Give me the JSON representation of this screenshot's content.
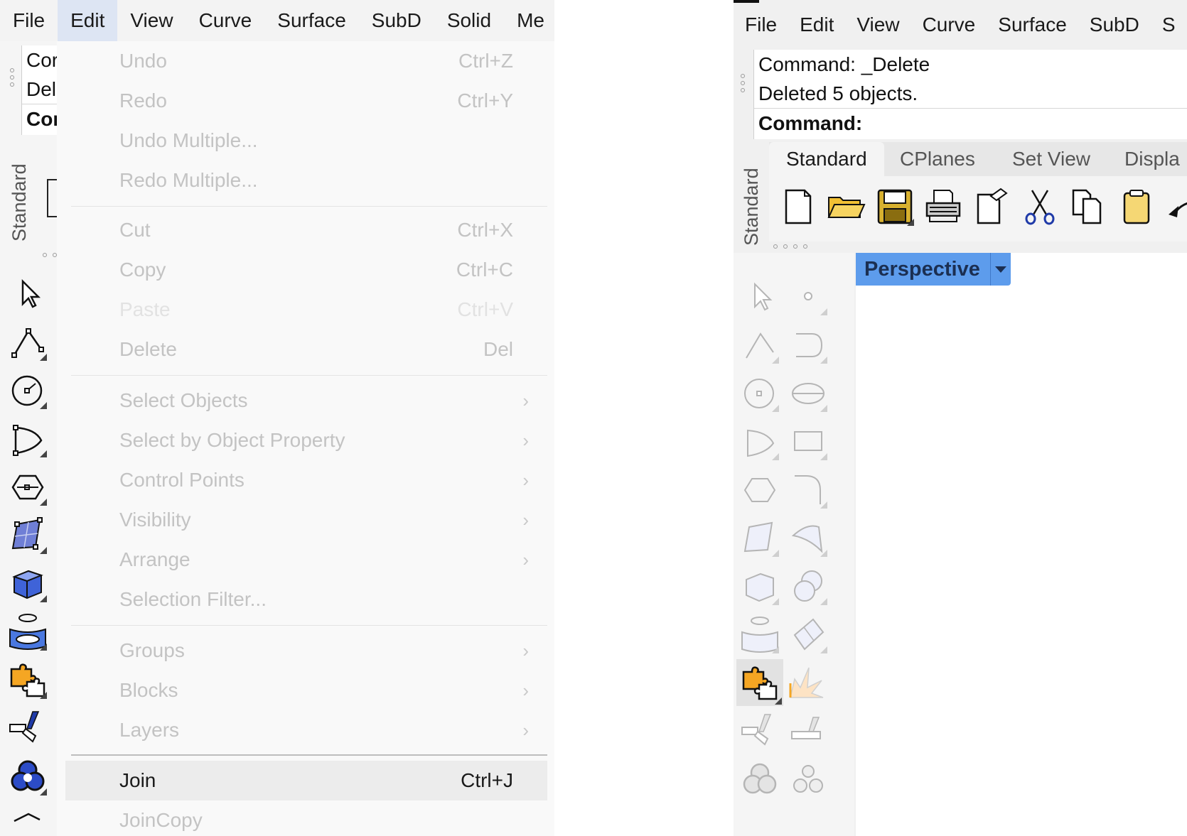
{
  "left": {
    "menubar": [
      "File",
      "Edit",
      "View",
      "Curve",
      "Surface",
      "SubD",
      "Solid",
      "Me"
    ],
    "history": [
      "Cor",
      "Del"
    ],
    "prompt": "Cor",
    "toolbar_label": "Standard"
  },
  "edit_menu": {
    "items": [
      {
        "label": "Undo",
        "shortcut": "Ctrl+Z"
      },
      {
        "label": "Redo",
        "shortcut": "Ctrl+Y"
      },
      {
        "label": "Undo Multiple...",
        "shortcut": ""
      },
      {
        "label": "Redo Multiple...",
        "shortcut": ""
      },
      {
        "label": "Cut",
        "shortcut": "Ctrl+X"
      },
      {
        "label": "Copy",
        "shortcut": "Ctrl+C"
      },
      {
        "label": "Paste",
        "shortcut": "Ctrl+V"
      },
      {
        "label": "Delete",
        "shortcut": "Del"
      },
      {
        "label": "Select Objects",
        "shortcut": ""
      },
      {
        "label": "Select by Object Property",
        "shortcut": ""
      },
      {
        "label": "Control Points",
        "shortcut": ""
      },
      {
        "label": "Visibility",
        "shortcut": ""
      },
      {
        "label": "Arrange",
        "shortcut": ""
      },
      {
        "label": "Selection Filter...",
        "shortcut": ""
      },
      {
        "label": "Groups",
        "shortcut": ""
      },
      {
        "label": "Blocks",
        "shortcut": ""
      },
      {
        "label": "Layers",
        "shortcut": ""
      },
      {
        "label": "Join",
        "shortcut": "Ctrl+J"
      },
      {
        "label": "JoinCopy",
        "shortcut": ""
      }
    ]
  },
  "right": {
    "menubar": [
      "File",
      "Edit",
      "View",
      "Curve",
      "Surface",
      "SubD",
      "S"
    ],
    "history": [
      "Command: _Delete",
      "Deleted 5 objects."
    ],
    "prompt": "Command:",
    "toolbar_label": "Standard",
    "tabs": [
      "Standard",
      "CPlanes",
      "Set View",
      "Displa"
    ],
    "viewport_title": "Perspective"
  },
  "colors": {
    "viewport_tab": "#5d9cec",
    "menu_highlight": "#dde5f3",
    "disabled_text": "#c3c3c3"
  }
}
